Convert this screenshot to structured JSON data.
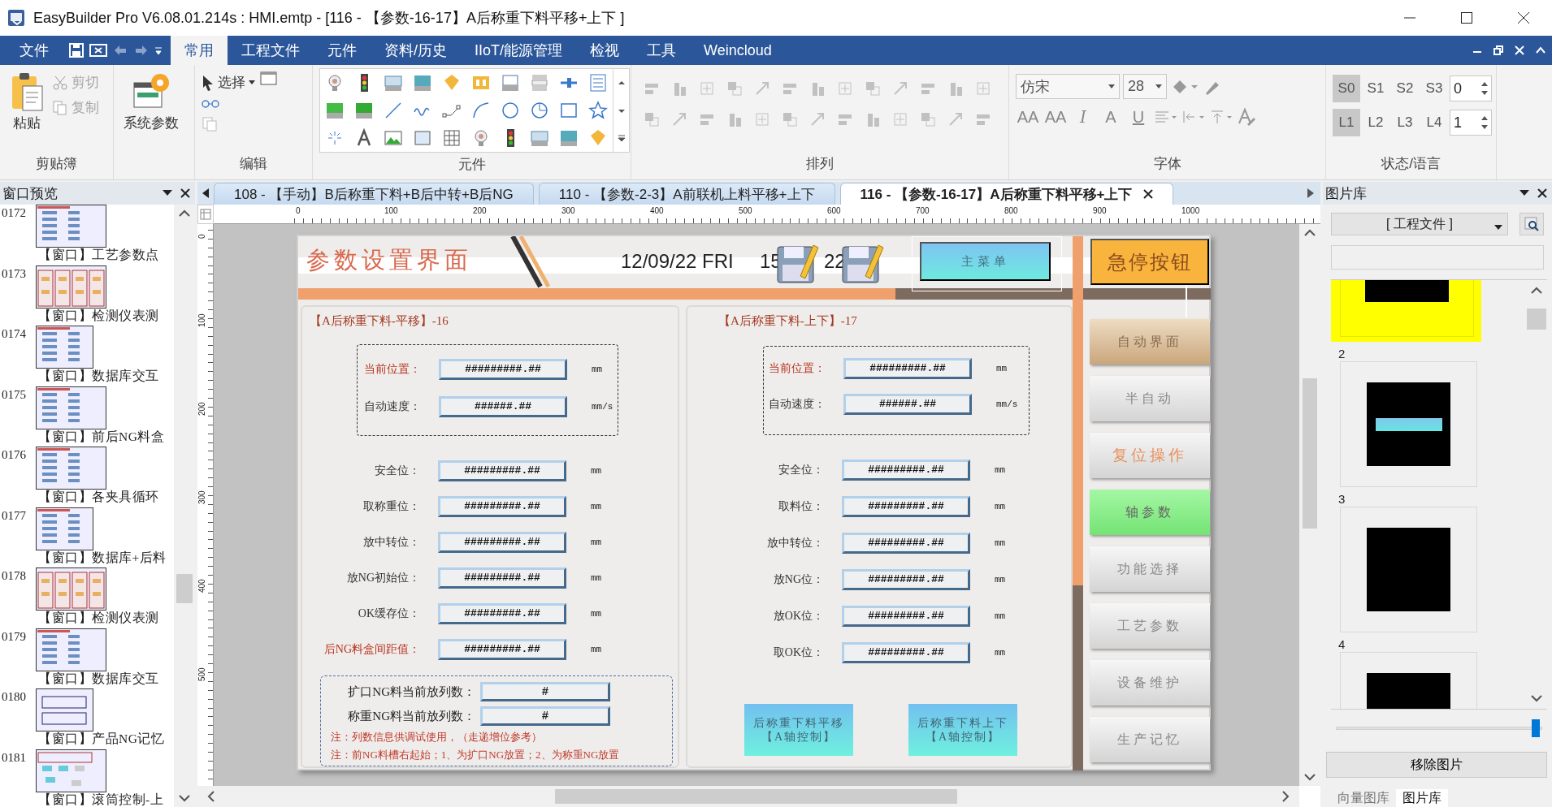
{
  "window": {
    "title": "EasyBuilder Pro V6.08.01.214s : HMI.emtp - [116 - 【参数-16-17】A后称重下料平移+上下 ]"
  },
  "menu": {
    "file": "文件",
    "tabs": [
      {
        "label": "常用",
        "selected": true
      },
      {
        "label": "工程文件",
        "selected": false
      },
      {
        "label": "元件",
        "selected": false
      },
      {
        "label": "资料/历史",
        "selected": false
      },
      {
        "label": "IIoT/能源管理",
        "selected": false
      },
      {
        "label": "检视",
        "selected": false
      },
      {
        "label": "工具",
        "selected": false
      },
      {
        "label": "Weincloud",
        "selected": false
      }
    ]
  },
  "ribbon": {
    "clipboard": {
      "label": "剪贴簿",
      "paste": "粘贴",
      "actions": [
        {
          "label": "剪切",
          "disabled": true
        },
        {
          "label": "复制",
          "disabled": true
        }
      ]
    },
    "system": {
      "button": "系统参数"
    },
    "edit": {
      "label": "编辑",
      "select": "选择"
    },
    "components": {
      "label": "元件"
    },
    "arrange": {
      "label": "排列",
      "disabled": true
    },
    "font": {
      "label": "字体",
      "family": "仿宋",
      "size": "28",
      "format_glyphs": [
        "AA",
        "AA",
        "I",
        "A",
        "U"
      ]
    },
    "state_language": {
      "label": "状态/语言",
      "states": [
        {
          "label": "S0",
          "selected": true
        },
        {
          "label": "S1",
          "selected": false
        },
        {
          "label": "S2",
          "selected": false
        },
        {
          "label": "S3",
          "selected": false
        }
      ],
      "state_value": "0",
      "languages": [
        {
          "label": "L1",
          "selected": true
        },
        {
          "label": "L2",
          "selected": false
        },
        {
          "label": "L3",
          "selected": false
        },
        {
          "label": "L4",
          "selected": false
        }
      ],
      "language_value": "1"
    }
  },
  "window_preview": {
    "title": "窗口预览",
    "items": [
      {
        "number": "0172",
        "label": "【窗口】工艺参数点"
      },
      {
        "number": "0173",
        "label": "【窗口】检测仪表测"
      },
      {
        "number": "0174",
        "label": "【窗口】数据库交互"
      },
      {
        "number": "0175",
        "label": "【窗口】前后NG料盒"
      },
      {
        "number": "0176",
        "label": "【窗口】各夹具循环"
      },
      {
        "number": "0177",
        "label": "【窗口】数据库+后料"
      },
      {
        "number": "0178",
        "label": "【窗口】检测仪表测"
      },
      {
        "number": "0179",
        "label": "【窗口】数据库交互"
      },
      {
        "number": "0180",
        "label": "【窗口】产品NG记忆"
      },
      {
        "number": "0181",
        "label": "【窗口】滚筒控制-上"
      }
    ]
  },
  "document_tabs": [
    {
      "label": "108 - 【手动】B后称重下料+B后中转+B后NG",
      "selected": false
    },
    {
      "label": "110 - 【参数-2-3】A前联机上料平移+上下",
      "selected": false
    },
    {
      "label": "116 - 【参数-16-17】A后称重下料平移+上下",
      "selected": true
    }
  ],
  "ruler": {
    "horizontal": [
      "0",
      "100",
      "200",
      "300",
      "400",
      "500",
      "600",
      "700",
      "800",
      "900",
      "1000"
    ],
    "vertical": [
      "0",
      "100",
      "200",
      "300",
      "400",
      "500"
    ]
  },
  "hmi": {
    "title": "参数设置界面",
    "date": "12/09/22 FRI",
    "time_parts": [
      "15",
      "22"
    ],
    "main_menu": "主菜单",
    "emergency_stop": "急停按钮",
    "nav_buttons": [
      {
        "label": "自动界面",
        "kind": "tan"
      },
      {
        "label": "半自动",
        "kind": "plain"
      },
      {
        "label": "复位操作",
        "kind": "warning"
      },
      {
        "label": "轴参数",
        "kind": "active"
      },
      {
        "label": "功能选择",
        "kind": "plain"
      },
      {
        "label": "工艺参数",
        "kind": "plain"
      },
      {
        "label": "设备维护",
        "kind": "plain"
      },
      {
        "label": "生产记忆",
        "kind": "plain"
      }
    ],
    "panels": [
      {
        "title": "【A后称重下料-平移】-16",
        "motion": [
          {
            "label": "当前位置：",
            "value": "#########.##",
            "unit": "mm",
            "color": "#b8321e"
          },
          {
            "label": "自动速度：",
            "value": "######.##",
            "unit": "mm/s",
            "color": "#333333"
          }
        ],
        "positions": [
          {
            "label": "安全位：",
            "value": "#########.##",
            "unit": "mm",
            "color": "#333333"
          },
          {
            "label": "取称重位：",
            "value": "#########.##",
            "unit": "mm",
            "color": "#333333"
          },
          {
            "label": "放中转位：",
            "value": "#########.##",
            "unit": "mm",
            "color": "#333333"
          },
          {
            "label": "放NG初始位：",
            "value": "#########.##",
            "unit": "mm",
            "color": "#333333"
          },
          {
            "label": "OK缓存位：",
            "value": "#########.##",
            "unit": "mm",
            "color": "#333333"
          },
          {
            "label": "后NG料盒间距值：",
            "value": "#########.##",
            "unit": "mm",
            "color": "#b8321e"
          }
        ],
        "counters": [
          {
            "label": "扩口NG料当前放列数：",
            "value": "#"
          },
          {
            "label": "称重NG料当前放列数：",
            "value": "#"
          }
        ],
        "notes": [
          "注：列数信息供调试使用，（走递增位参考）",
          "注：前NG料槽右起始；1、为扩口NG放置；2、为称重NG放置"
        ]
      },
      {
        "title": "【A后称重下料-上下】-17",
        "motion": [
          {
            "label": "当前位置：",
            "value": "#########.##",
            "unit": "mm",
            "color": "#b8321e"
          },
          {
            "label": "自动速度：",
            "value": "######.##",
            "unit": "mm/s",
            "color": "#333333"
          }
        ],
        "positions": [
          {
            "label": "安全位：",
            "value": "#########.##",
            "unit": "mm",
            "color": "#333333"
          },
          {
            "label": "取料位：",
            "value": "#########.##",
            "unit": "mm",
            "color": "#333333"
          },
          {
            "label": "放中转位：",
            "value": "#########.##",
            "unit": "mm",
            "color": "#333333"
          },
          {
            "label": "放NG位：",
            "value": "#########.##",
            "unit": "mm",
            "color": "#333333"
          },
          {
            "label": "放OK位：",
            "value": "#########.##",
            "unit": "mm",
            "color": "#333333"
          },
          {
            "label": "取OK位：",
            "value": "#########.##",
            "unit": "mm",
            "color": "#333333"
          }
        ],
        "buttons": [
          [
            "后称重下料平移",
            "【A轴控制】"
          ],
          [
            "后称重下料上下",
            "【A轴控制】"
          ]
        ]
      }
    ]
  },
  "picture_library": {
    "title": "图片库",
    "source": "[ 工程文件 ]",
    "items": [
      {
        "selected": true,
        "kind": "plain"
      },
      {
        "number": "2",
        "selected": false,
        "kind": "bar"
      },
      {
        "number": "3",
        "selected": false,
        "kind": "plain"
      },
      {
        "number": "4",
        "selected": false,
        "kind": "plain"
      }
    ],
    "zoom": {
      "level": 0.97
    },
    "remove": "移除图片",
    "tabs": [
      {
        "label": "向量图库",
        "selected": false
      },
      {
        "label": "图片库",
        "selected": true
      }
    ]
  }
}
